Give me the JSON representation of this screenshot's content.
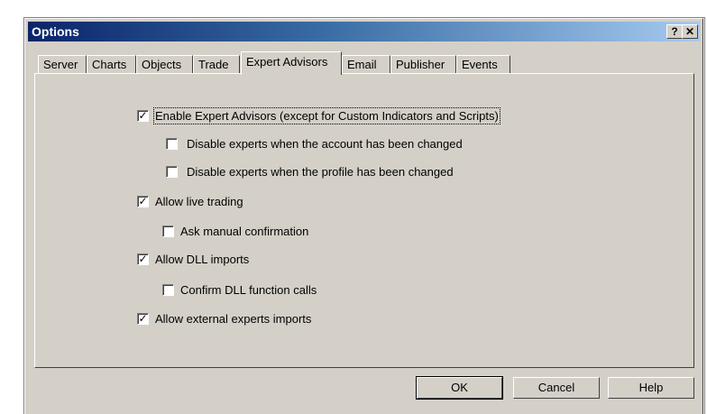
{
  "window": {
    "title": "Options",
    "help_btn": "?",
    "close_btn": "✕"
  },
  "tabs": [
    {
      "label": "Server"
    },
    {
      "label": "Charts"
    },
    {
      "label": "Objects"
    },
    {
      "label": "Trade"
    },
    {
      "label": "Expert Advisors",
      "active": true
    },
    {
      "label": "Email"
    },
    {
      "label": "Publisher"
    },
    {
      "label": "Events"
    }
  ],
  "options": [
    {
      "label": "Enable Expert Advisors (except for Custom Indicators and Scripts)",
      "checked": "✓"
    },
    {
      "label": "Disable experts when the account has been changed",
      "checked": ""
    },
    {
      "label": "Disable experts when the profile has been changed",
      "checked": ""
    },
    {
      "label": "Allow live trading",
      "checked": "✓"
    },
    {
      "label": "Ask manual confirmation",
      "checked": ""
    },
    {
      "label": "Allow DLL imports",
      "checked": "✓"
    },
    {
      "label": "Confirm DLL function calls",
      "checked": ""
    },
    {
      "label": "Allow external experts imports",
      "checked": "✓"
    }
  ],
  "buttons": {
    "ok": "OK",
    "cancel": "Cancel",
    "help": "Help"
  }
}
